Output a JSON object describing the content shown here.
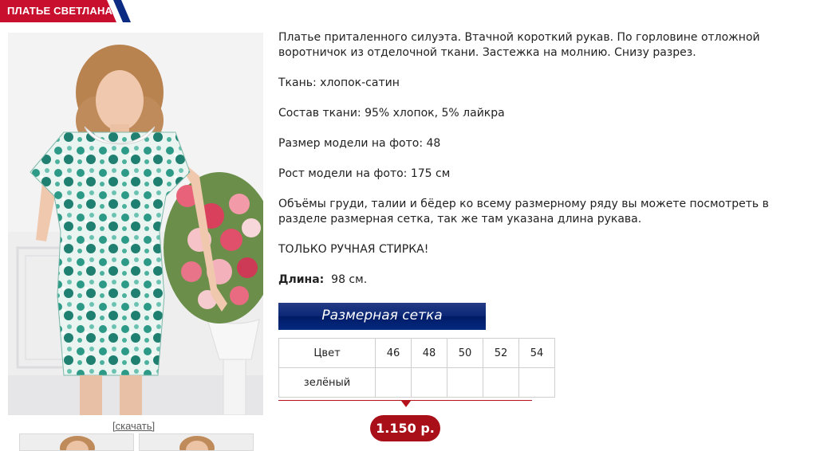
{
  "colors": {
    "brand_red": "#c8102e",
    "brand_blue": "#0c2c84",
    "price_red": "#a90f18"
  },
  "header": {
    "title": "ПЛАТЬЕ СВЕТЛАНА"
  },
  "gallery": {
    "main_image_icon": "product-photo",
    "download_label": "[скачать]"
  },
  "description": {
    "paragraphs": [
      "Платье приталенного силуэта. Втачной короткий рукав. По горловине отложной воротничок из отделочной ткани. Застежка на молнию. Снизу разрез.",
      "Ткань: хлопок-сатин",
      "Состав ткани: 95% хлопок, 5% лайкра",
      "Размер модели на фото: 48",
      "Рост модели на фото: 175 см",
      "Объёмы груди, талии и бёдер ко всему размерному ряду вы можете посмотреть в разделе размерная сетка, так же там указана длина рукава.",
      "ТОЛЬКО РУЧНАЯ СТИРКА!"
    ],
    "length_label": "Длина:",
    "length_value": "98 см."
  },
  "size_chart_button": {
    "label": "Размерная сетка"
  },
  "size_table": {
    "color_header": "Цвет",
    "sizes": [
      "46",
      "48",
      "50",
      "52",
      "54"
    ],
    "rows": [
      {
        "color": "зелёный"
      }
    ]
  },
  "price": {
    "value": "1.150 р."
  }
}
